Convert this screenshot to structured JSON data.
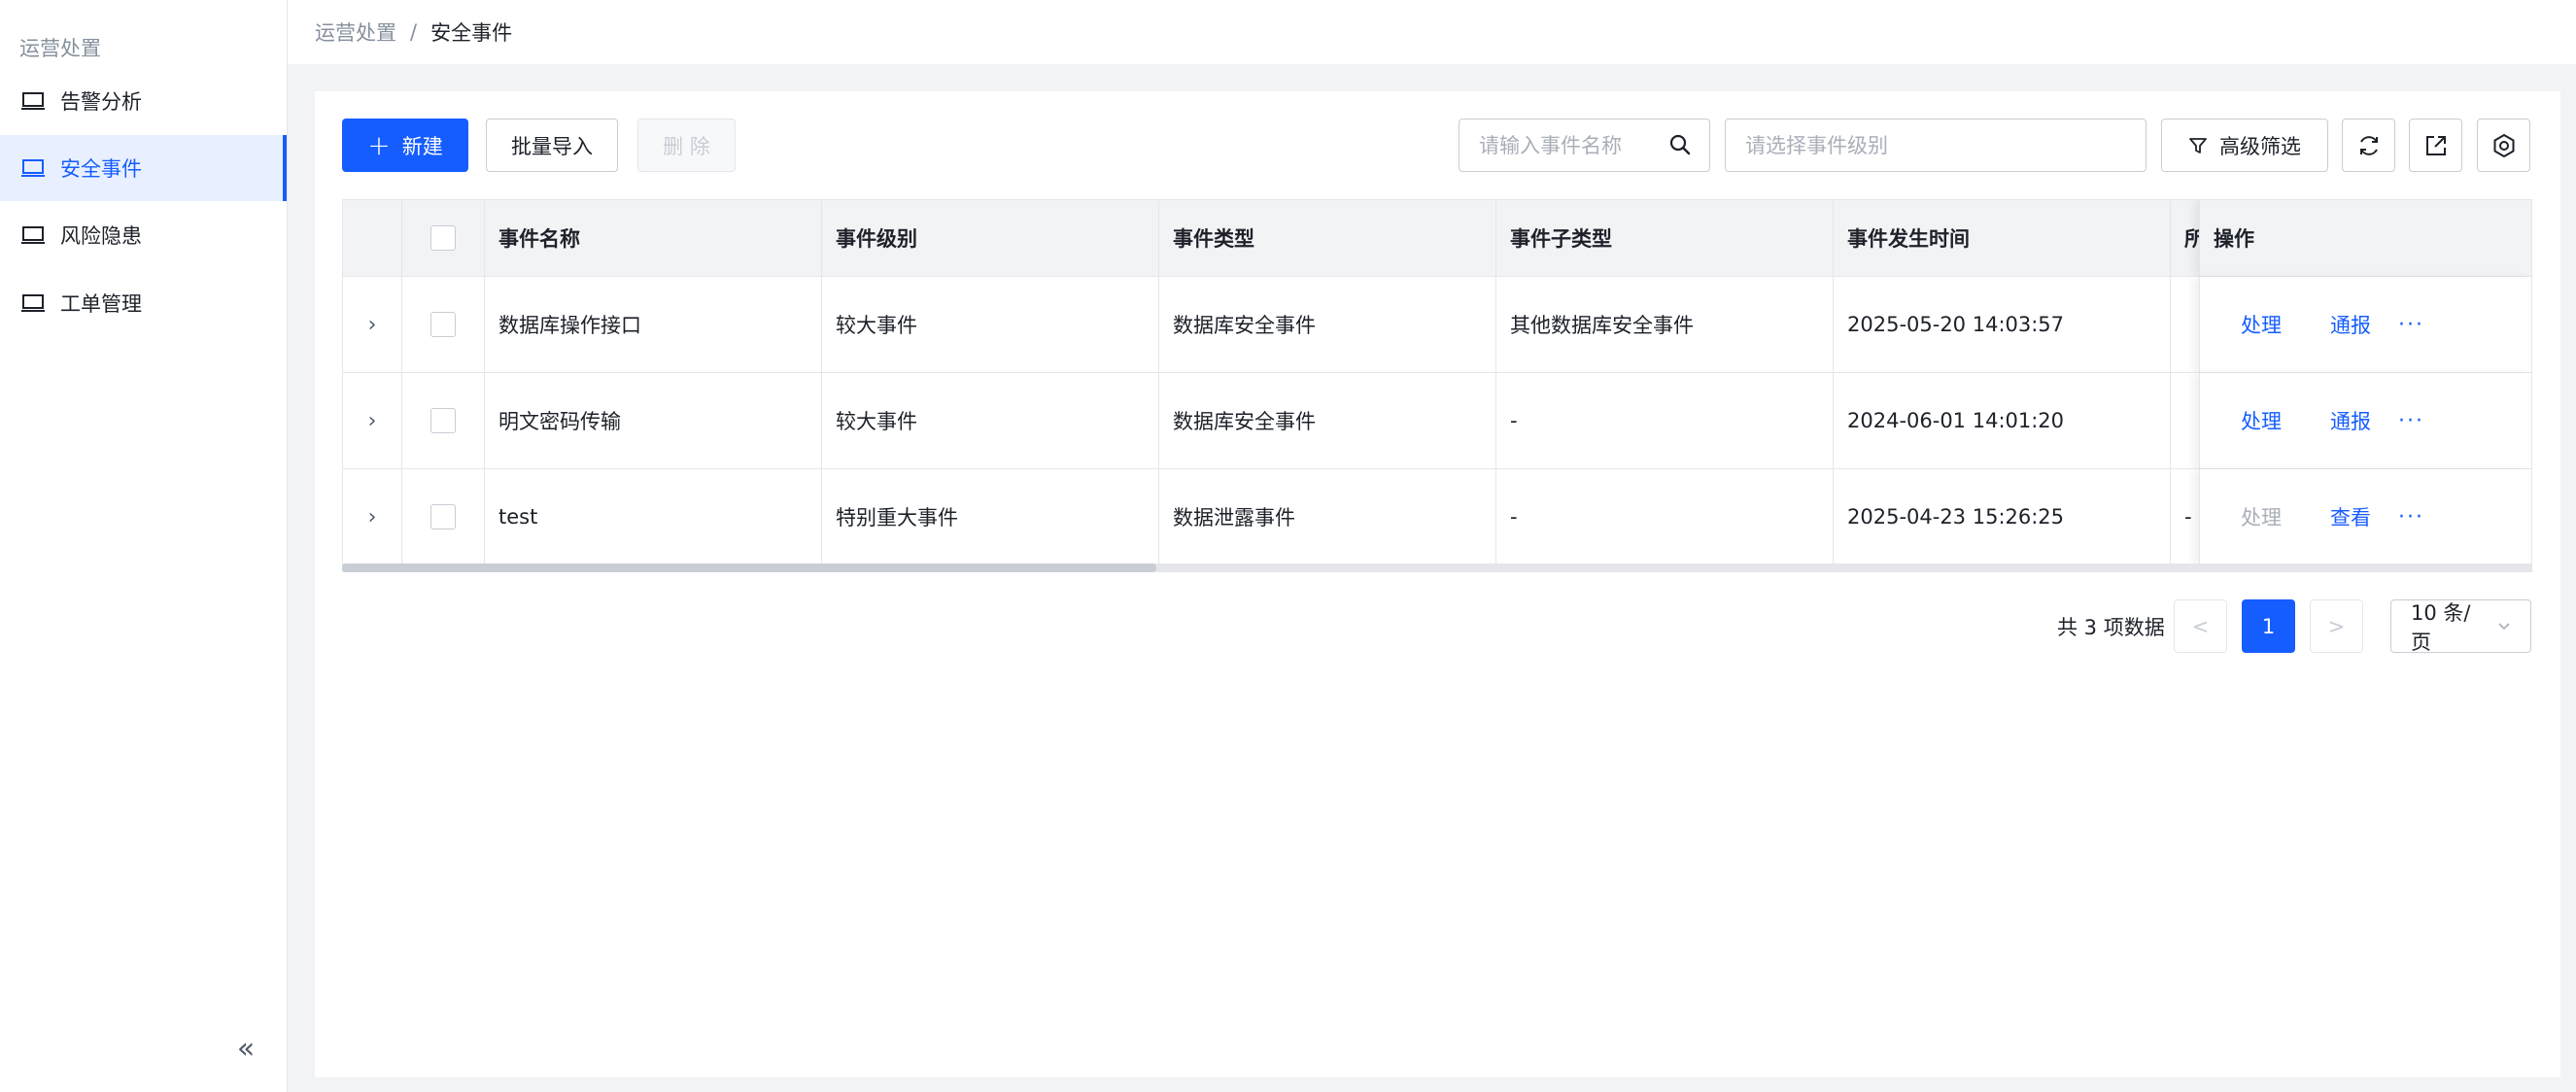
{
  "sidebar": {
    "group_label": "运营处置",
    "items": [
      {
        "label": "告警分析",
        "icon": "monitor-icon",
        "active": false
      },
      {
        "label": "安全事件",
        "icon": "monitor-icon",
        "active": true
      },
      {
        "label": "风险隐患",
        "icon": "monitor-icon",
        "active": false
      },
      {
        "label": "工单管理",
        "icon": "monitor-icon",
        "active": false
      }
    ],
    "collapse_glyph": "«"
  },
  "breadcrumb": {
    "parent": "运营处置",
    "separator": "/",
    "current": "安全事件"
  },
  "toolbar": {
    "new_label": "新建",
    "new_icon": "+",
    "import_label": "批量导入",
    "delete_label": "删 除",
    "search_placeholder": "请输入事件名称",
    "level_placeholder": "请选择事件级别",
    "advanced_filter_label": "高级筛选"
  },
  "table": {
    "headers": {
      "name": "事件名称",
      "level": "事件级别",
      "type": "事件类型",
      "subtype": "事件子类型",
      "time": "事件发生时间",
      "partial": "所",
      "actions": "操作"
    },
    "rows": [
      {
        "name": "数据库操作接口",
        "level": "较大事件",
        "type": "数据库安全事件",
        "subtype": "其他数据库安全事件",
        "time": "2025-05-20 14:03:57",
        "partial": "",
        "action1": "处理",
        "action1_disabled": false,
        "action2": "通报",
        "more": "···"
      },
      {
        "name": "明文密码传输",
        "level": "较大事件",
        "type": "数据库安全事件",
        "subtype": "-",
        "time": "2024-06-01 14:01:20",
        "partial": "",
        "action1": "处理",
        "action1_disabled": false,
        "action2": "通报",
        "more": "···"
      },
      {
        "name": "test",
        "level": "特别重大事件",
        "type": "数据泄露事件",
        "subtype": "-",
        "time": "2025-04-23 15:26:25",
        "partial": "-",
        "action1": "处理",
        "action1_disabled": true,
        "action2": "查看",
        "more": "···"
      }
    ]
  },
  "pagination": {
    "total_text": "共 3 项数据",
    "prev": "<",
    "current_page": "1",
    "next": ">",
    "page_size": "10 条/页"
  },
  "colors": {
    "primary": "#165dff",
    "sidebar_active_bg": "#e8f0ff"
  }
}
